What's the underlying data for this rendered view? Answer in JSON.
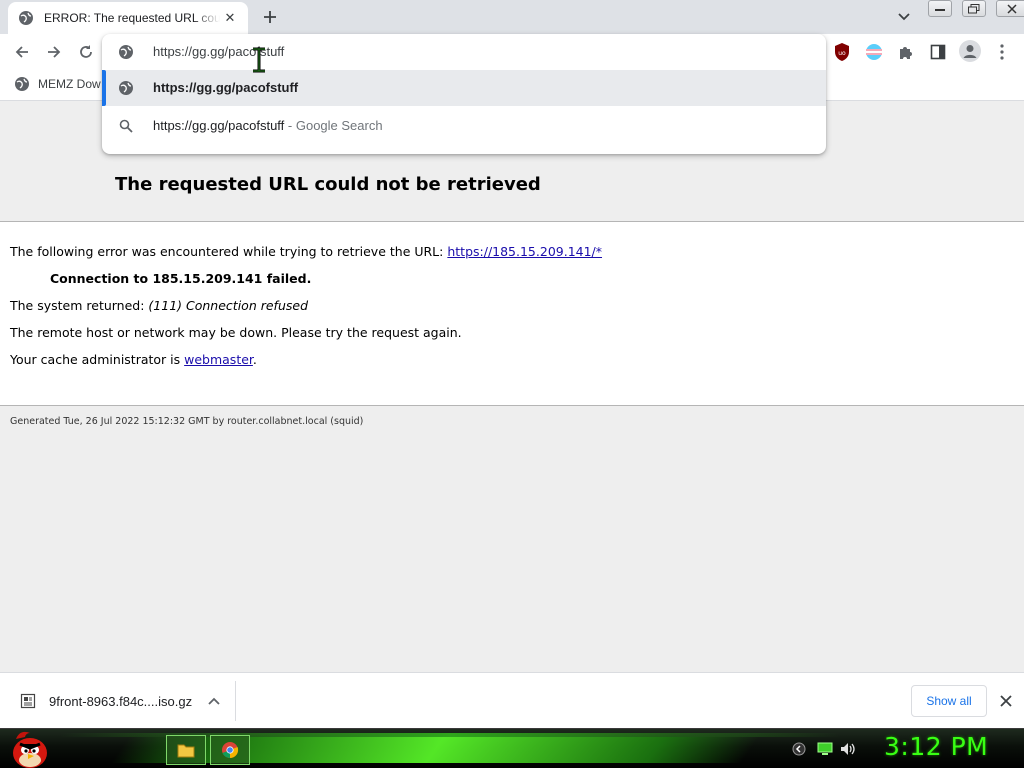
{
  "tab": {
    "title": "ERROR: The requested URL could not be retrieved",
    "close_glyph": "✕"
  },
  "toolbar": {
    "back_icon": "arrow-left-icon",
    "forward_icon": "arrow-right-icon",
    "reload_icon": "reload-icon",
    "extensions": [
      "ublock-origin-icon",
      "pride-flag-extension-icon",
      "puzzle-extensions-icon",
      "side-panel-icon",
      "profile-avatar-icon",
      "more-menu-icon"
    ]
  },
  "omnibox": {
    "input_value": "https://gg.gg/pacofstuff",
    "suggestions": [
      {
        "text": "https://gg.gg/pacofstuff",
        "suffix": "",
        "selected": true
      },
      {
        "text": "https://gg.gg/pacofstuff",
        "suffix": " - Google Search",
        "selected": false
      }
    ]
  },
  "bookmarks": {
    "items": [
      {
        "label": "MEMZ Dow"
      }
    ]
  },
  "page": {
    "title": "The requested URL could not be retrieved",
    "line1_prefix": "The following error was encountered while trying to retrieve the URL: ",
    "line1_link": "https://185.15.209.141/*",
    "line2": "Connection to 185.15.209.141 failed.",
    "line3_prefix": "The system returned: ",
    "line3_italic": "(111) Connection refused",
    "line4": "The remote host or network may be down. Please try the request again.",
    "line5_prefix": "Your cache administrator is ",
    "line5_link": "webmaster",
    "line5_suffix": ".",
    "footer": "Generated Tue, 26 Jul 2022 15:12:32 GMT by router.collabnet.local (squid)"
  },
  "downloads": {
    "items": [
      {
        "name": "9front-8963.f84c....iso.gz"
      }
    ],
    "show_all": "Show all"
  },
  "taskbar": {
    "clock": "3:12 PM",
    "pinned": [
      "file-explorer-icon",
      "chrome-icon"
    ],
    "tray": [
      "tray-arrow-icon",
      "network-icon",
      "volume-icon"
    ]
  },
  "colors": {
    "accent": "#1a73e8",
    "link": "#1a0dab",
    "clock": "#39ff14",
    "taskbar_glow": "#5cff2a"
  }
}
